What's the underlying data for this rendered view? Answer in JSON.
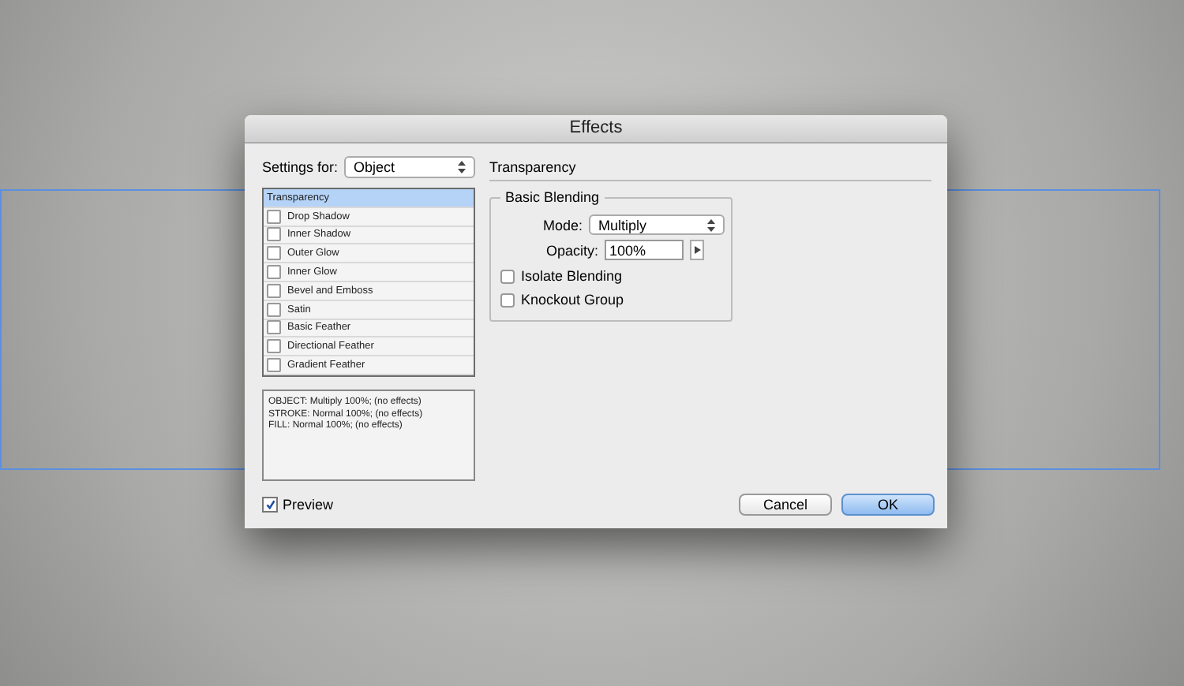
{
  "window": {
    "title": "Effects"
  },
  "settings_for": {
    "label": "Settings for:",
    "value": "Object"
  },
  "effects": [
    {
      "label": "Transparency",
      "kind": "plain",
      "selected": true
    },
    {
      "label": "Drop Shadow",
      "kind": "check",
      "selected": false,
      "checked": false
    },
    {
      "label": "Inner Shadow",
      "kind": "check",
      "selected": false,
      "checked": false
    },
    {
      "label": "Outer Glow",
      "kind": "check",
      "selected": false,
      "checked": false
    },
    {
      "label": "Inner Glow",
      "kind": "check",
      "selected": false,
      "checked": false
    },
    {
      "label": "Bevel and Emboss",
      "kind": "check",
      "selected": false,
      "checked": false
    },
    {
      "label": "Satin",
      "kind": "check",
      "selected": false,
      "checked": false
    },
    {
      "label": "Basic Feather",
      "kind": "check",
      "selected": false,
      "checked": false
    },
    {
      "label": "Directional Feather",
      "kind": "check",
      "selected": false,
      "checked": false
    },
    {
      "label": "Gradient Feather",
      "kind": "check",
      "selected": false,
      "checked": false
    }
  ],
  "summary": [
    "OBJECT: Multiply 100%; (no effects)",
    "STROKE: Normal 100%; (no effects)",
    "FILL: Normal 100%; (no effects)"
  ],
  "panel": {
    "title": "Transparency",
    "group": "Basic Blending",
    "mode_label": "Mode:",
    "mode": "Multiply",
    "opacity_label": "Opacity:",
    "opacity": "100%",
    "options": [
      {
        "label": "Isolate Blending",
        "checked": false
      },
      {
        "label": "Knockout Group",
        "checked": false
      }
    ]
  },
  "preview": {
    "label": "Preview",
    "checked": true
  },
  "buttons": [
    {
      "label": "Cancel",
      "kind": "cancel"
    },
    {
      "label": "OK",
      "kind": "default"
    }
  ]
}
